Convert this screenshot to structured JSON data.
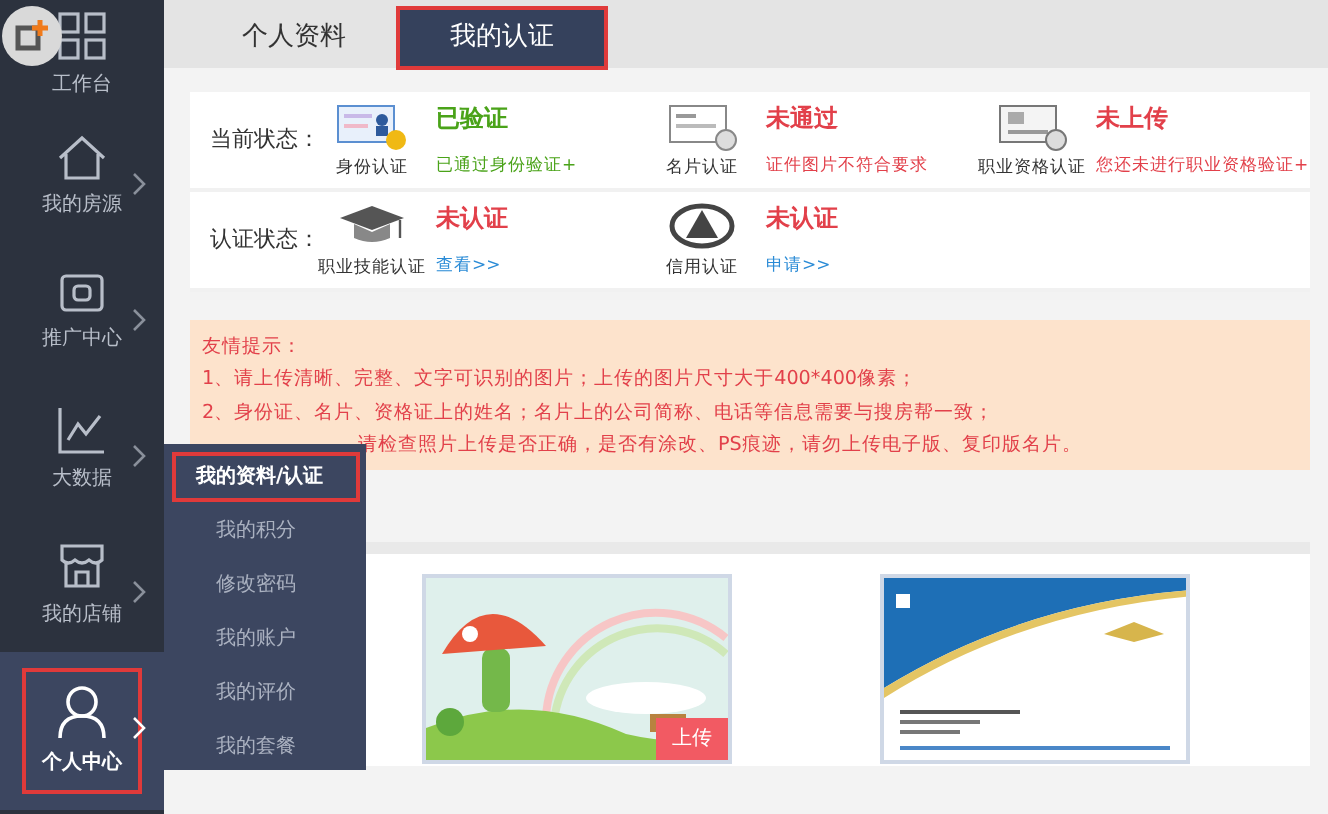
{
  "sidebar": {
    "items": [
      {
        "label": "工作台",
        "kind": "grid",
        "selected": false,
        "arrow": false
      },
      {
        "label": "我的房源",
        "kind": "house",
        "selected": false,
        "arrow": true
      },
      {
        "label": "推广中心",
        "kind": "screen",
        "selected": false,
        "arrow": true
      },
      {
        "label": "大数据",
        "kind": "chart",
        "selected": false,
        "arrow": true
      },
      {
        "label": "我的店铺",
        "kind": "shop",
        "selected": false,
        "arrow": true
      },
      {
        "label": "个人中心",
        "kind": "person",
        "selected": true,
        "arrow": true
      }
    ]
  },
  "submenu": {
    "items": [
      {
        "label": "我的资料/认证",
        "selected": true
      },
      {
        "label": "我的积分",
        "selected": false
      },
      {
        "label": "修改密码",
        "selected": false
      },
      {
        "label": "我的账户",
        "selected": false
      },
      {
        "label": "我的评价",
        "selected": false
      },
      {
        "label": "我的套餐",
        "selected": false
      }
    ]
  },
  "tabs": [
    {
      "label": "个人资料",
      "selected": false
    },
    {
      "label": "我的认证",
      "selected": true
    }
  ],
  "status_rows": [
    {
      "label": "当前状态：",
      "items": [
        {
          "kind": "id-card",
          "caption": "身份认证",
          "status": "已验证",
          "verified": true,
          "note": {
            "text": "已通过身份验证+",
            "kind": "text"
          }
        },
        {
          "kind": "business-card",
          "caption": "名片认证",
          "status": "未通过",
          "verified": false,
          "note": {
            "text": "证件图片不符合要求",
            "kind": "text"
          }
        },
        {
          "kind": "certificate",
          "caption": "职业资格认证",
          "status": "未上传",
          "verified": false,
          "note": {
            "text": "您还未进行职业资格验证+",
            "kind": "text"
          }
        }
      ]
    },
    {
      "label": "认证状态：",
      "items": [
        {
          "kind": "graduation-cap",
          "caption": "职业技能认证",
          "status": "未认证",
          "verified": false,
          "note": {
            "text": "查看>>",
            "kind": "link"
          }
        },
        {
          "kind": "credit-logo",
          "caption": "信用认证",
          "status": "未认证",
          "verified": false,
          "note": {
            "text": "申请>>",
            "kind": "link"
          }
        }
      ]
    }
  ],
  "tips": {
    "title": "友情提示：",
    "lines": [
      {
        "text": "1、请上传清晰、完整、文字可识别的图片；上传的图片尺寸大于400*400像素；",
        "kind": "full"
      },
      {
        "text": "2、身份证、名片、资格证上的姓名；名片上的公司简称、电话等信息需要与搜房帮一致；",
        "kind": "full"
      },
      {
        "text": "请检查照片上传是否正确，是否有涂改、PS痕迹，请勿上传电子版、复印版名片。",
        "kind": "covered"
      }
    ]
  },
  "uploads": [
    {
      "kind": "scenery",
      "button": "上传"
    },
    {
      "kind": "card"
    }
  ]
}
